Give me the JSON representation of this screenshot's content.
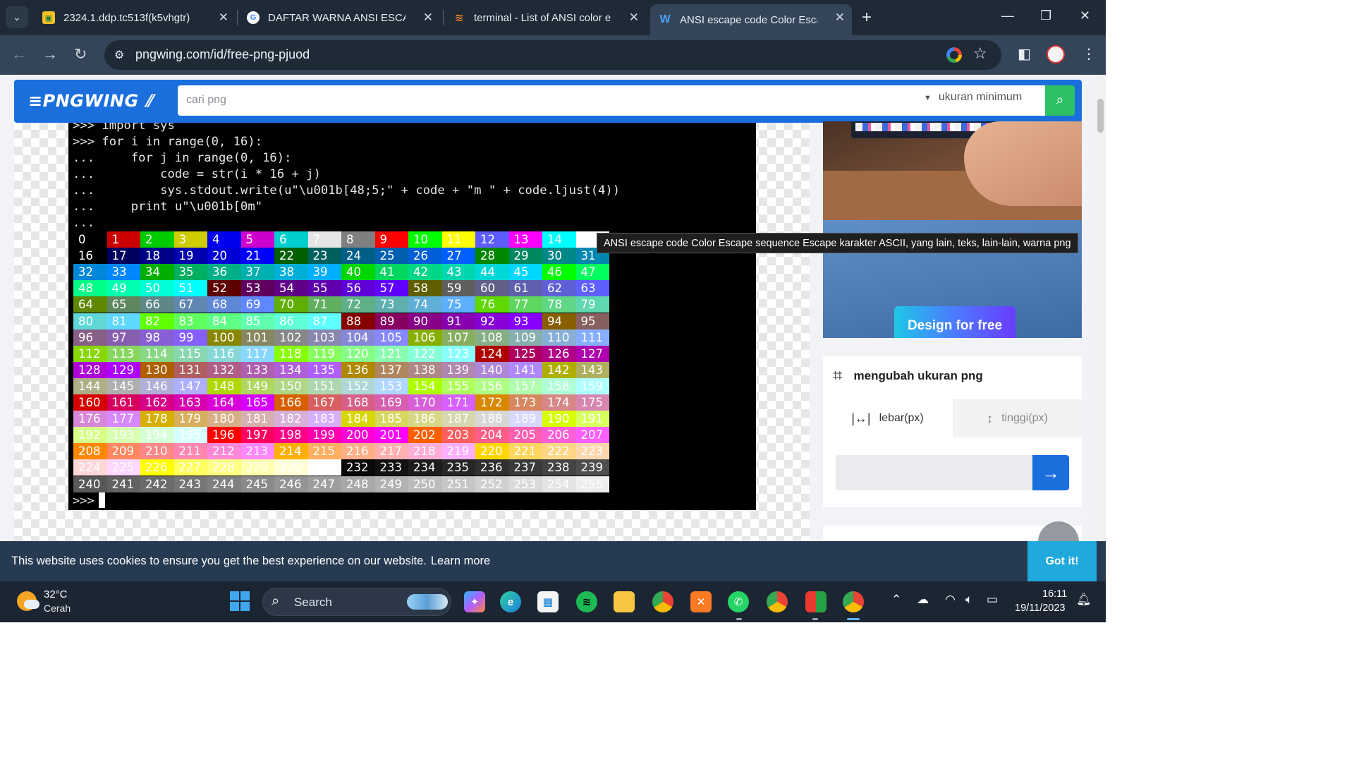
{
  "browser": {
    "tabs": [
      {
        "title": "2324.1.ddp.tc513f(k5vhgtr)",
        "favicon": "classroom-icon",
        "favicon_color": "#f6c026"
      },
      {
        "title": "DAFTAR WARNA ANSI ESCAPE",
        "favicon": "google-icon",
        "favicon_color": "#ffffff"
      },
      {
        "title": "terminal - List of ANSI color esc",
        "favicon": "stackoverflow-icon",
        "favicon_color": "#f48024"
      },
      {
        "title": "ANSI escape code Color Escape",
        "favicon": "pngwing-icon",
        "favicon_color": "#4aa3ff"
      }
    ],
    "url": "pngwing.com/id/free-png-pjuod"
  },
  "site": {
    "logo": "PNGWING",
    "search_placeholder": "cari png",
    "size_filter": "ukuran minimum"
  },
  "terminal": {
    "code_lines": [
      ">>> import sys",
      ">>> for i in range(0, 16):",
      "...     for j in range(0, 16):",
      "...         code = str(i * 16 + j)",
      "...         sys.stdout.write(u\"\\u001b[48;5;\" + code + \"m \" + code.ljust(4))",
      "...     print u\"\\u001b[0m\"",
      "..."
    ],
    "prompt": ">>>"
  },
  "tooltip": "ANSI escape code Color Escape sequence Escape karakter ASCII, yang lain, teks, lain-lain, warna png",
  "ad": {
    "button": "Design for free"
  },
  "resize": {
    "title": "mengubah ukuran png",
    "width_tab": "lebar(px)",
    "height_tab": "tinggi(px)"
  },
  "cookie": {
    "text": "This website uses cookies to ensure you get the best experience on our website.",
    "link": "Learn more",
    "button": "Got it!"
  },
  "taskbar": {
    "temperature": "32°C",
    "condition": "Cerah",
    "search": "Search",
    "time": "16:11",
    "date": "19/11/2023"
  }
}
